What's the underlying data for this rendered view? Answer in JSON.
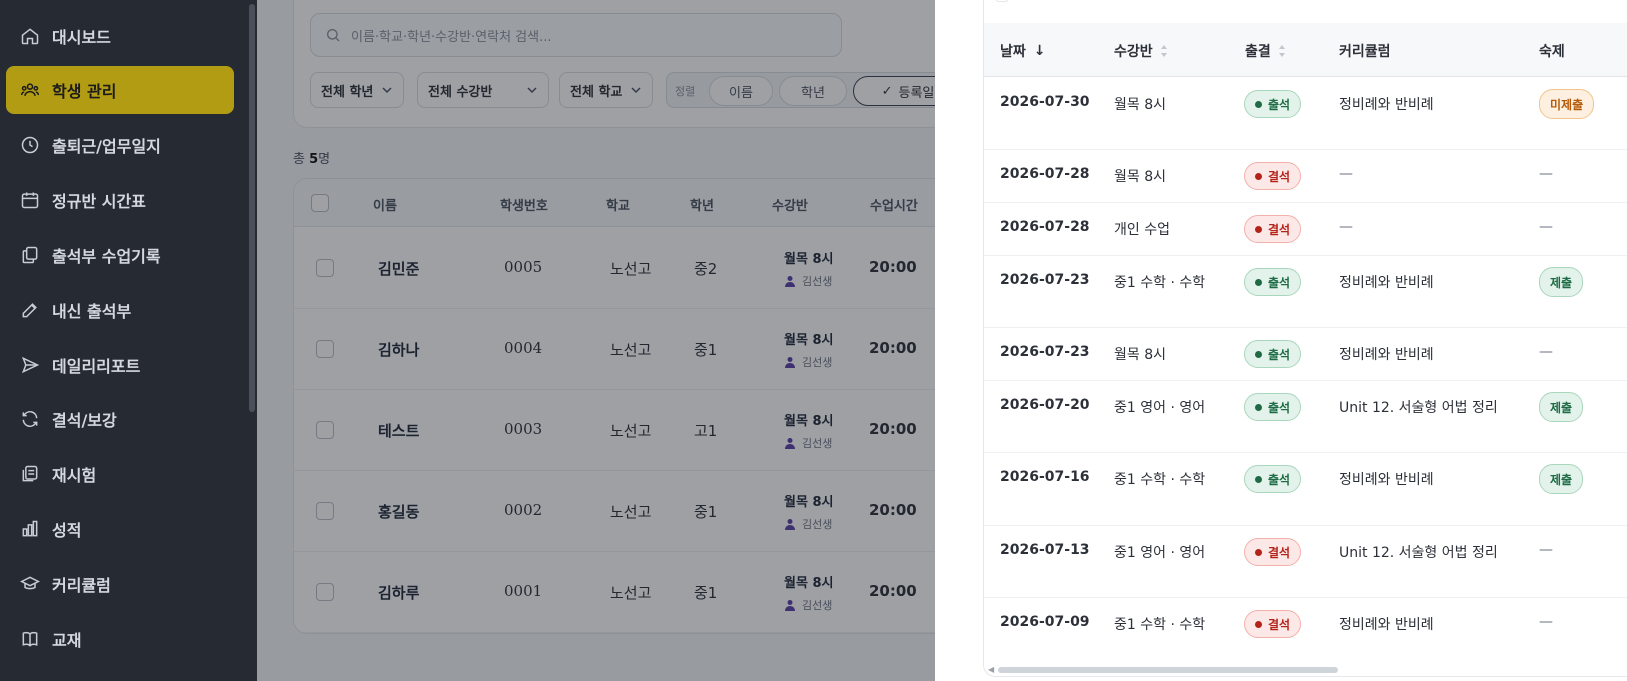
{
  "sidebar": {
    "items": [
      {
        "label": "대시보드",
        "icon": "home-icon",
        "active": false
      },
      {
        "label": "학생 관리",
        "icon": "users-icon",
        "active": true
      },
      {
        "label": "출퇴근/업무일지",
        "icon": "clock-icon",
        "active": false
      },
      {
        "label": "정규반 시간표",
        "icon": "calendar-icon",
        "active": false
      },
      {
        "label": "출석부 수업기록",
        "icon": "clipboard-copy-icon",
        "active": false
      },
      {
        "label": "내신 출석부",
        "icon": "edit-icon",
        "active": false
      },
      {
        "label": "데일리리포트",
        "icon": "send-icon",
        "active": false
      },
      {
        "label": "결석/보강",
        "icon": "refresh-icon",
        "active": false
      },
      {
        "label": "재시험",
        "icon": "copy-icon",
        "active": false
      },
      {
        "label": "성적",
        "icon": "bar-chart-icon",
        "active": false
      },
      {
        "label": "커리큘럼",
        "icon": "graduation-cap-icon",
        "active": false
      },
      {
        "label": "교재",
        "icon": "book-icon",
        "active": false
      }
    ],
    "accent": "#b29c13"
  },
  "filters": {
    "search_placeholder": "이름·학교·학년·수강반·연락처 검색...",
    "grade": "전체 학년",
    "class": "전체 수강반",
    "school": "전체 학교",
    "sort_label": "정렬",
    "sort_options": [
      "이름",
      "학년",
      "등록일"
    ],
    "sort_active": "등록일",
    "sort_check": "✓"
  },
  "summary": {
    "prefix": "총 ",
    "count": "5",
    "suffix": "명"
  },
  "students": {
    "headers": {
      "name": "이름",
      "id": "학생번호",
      "school": "학교",
      "grade": "학년",
      "class": "수강반",
      "time": "수업시간"
    },
    "rows": [
      {
        "name": "김민준",
        "id": "0005",
        "school": "노선고",
        "grade": "중2",
        "class": "월목 8시",
        "teacher": "김선생",
        "time": "20:00"
      },
      {
        "name": "김하나",
        "id": "0004",
        "school": "노선고",
        "grade": "중1",
        "class": "월목 8시",
        "teacher": "김선생",
        "time": "20:00"
      },
      {
        "name": "테스트",
        "id": "0003",
        "school": "노선고",
        "grade": "고1",
        "class": "월목 8시",
        "teacher": "김선생",
        "time": "20:00"
      },
      {
        "name": "홍길동",
        "id": "0002",
        "school": "노선고",
        "grade": "중1",
        "class": "월목 8시",
        "teacher": "김선생",
        "time": "20:00"
      },
      {
        "name": "김하루",
        "id": "0001",
        "school": "노선고",
        "grade": "중1",
        "class": "월목 8시",
        "teacher": "김선생",
        "time": "20:00"
      }
    ]
  },
  "attendance": {
    "headers": {
      "date": "날짜",
      "date_sort": "↓",
      "class": "수강반",
      "status": "출결",
      "curriculum": "커리큘럼",
      "homework": "숙제"
    },
    "rows": [
      {
        "date": "2026-07-30",
        "class": "월목 8시",
        "status": "출석",
        "status_type": "present",
        "curriculum": "정비례와 반비례",
        "homework": "미제출",
        "hw_type": "unsubmitted"
      },
      {
        "date": "2026-07-28",
        "class": "월목 8시",
        "status": "결석",
        "status_type": "absent",
        "curriculum": "—",
        "homework": "—",
        "hw_type": "none"
      },
      {
        "date": "2026-07-28",
        "class": "개인 수업",
        "status": "결석",
        "status_type": "absent",
        "curriculum": "—",
        "homework": "—",
        "hw_type": "none"
      },
      {
        "date": "2026-07-23",
        "class": "중1 수학 · 수학",
        "status": "출석",
        "status_type": "present",
        "curriculum": "정비례와 반비례",
        "homework": "제출",
        "hw_type": "submitted"
      },
      {
        "date": "2026-07-23",
        "class": "월목 8시",
        "status": "출석",
        "status_type": "present",
        "curriculum": "정비례와 반비례",
        "homework": "—",
        "hw_type": "none"
      },
      {
        "date": "2026-07-20",
        "class": "중1 영어 · 영어",
        "status": "출석",
        "status_type": "present",
        "curriculum": "Unit 12. 서술형 어법 정리",
        "homework": "제출",
        "hw_type": "submitted"
      },
      {
        "date": "2026-07-16",
        "class": "중1 수학 · 수학",
        "status": "출석",
        "status_type": "present",
        "curriculum": "정비례와 반비례",
        "homework": "제출",
        "hw_type": "submitted"
      },
      {
        "date": "2026-07-13",
        "class": "중1 영어 · 영어",
        "status": "결석",
        "status_type": "absent",
        "curriculum": "Unit 12. 서술형 어법 정리",
        "homework": "—",
        "hw_type": "none"
      },
      {
        "date": "2026-07-09",
        "class": "중1 수학 · 수학",
        "status": "결석",
        "status_type": "absent",
        "curriculum": "정비례와 반비례",
        "homework": "—",
        "hw_type": "none"
      }
    ]
  }
}
